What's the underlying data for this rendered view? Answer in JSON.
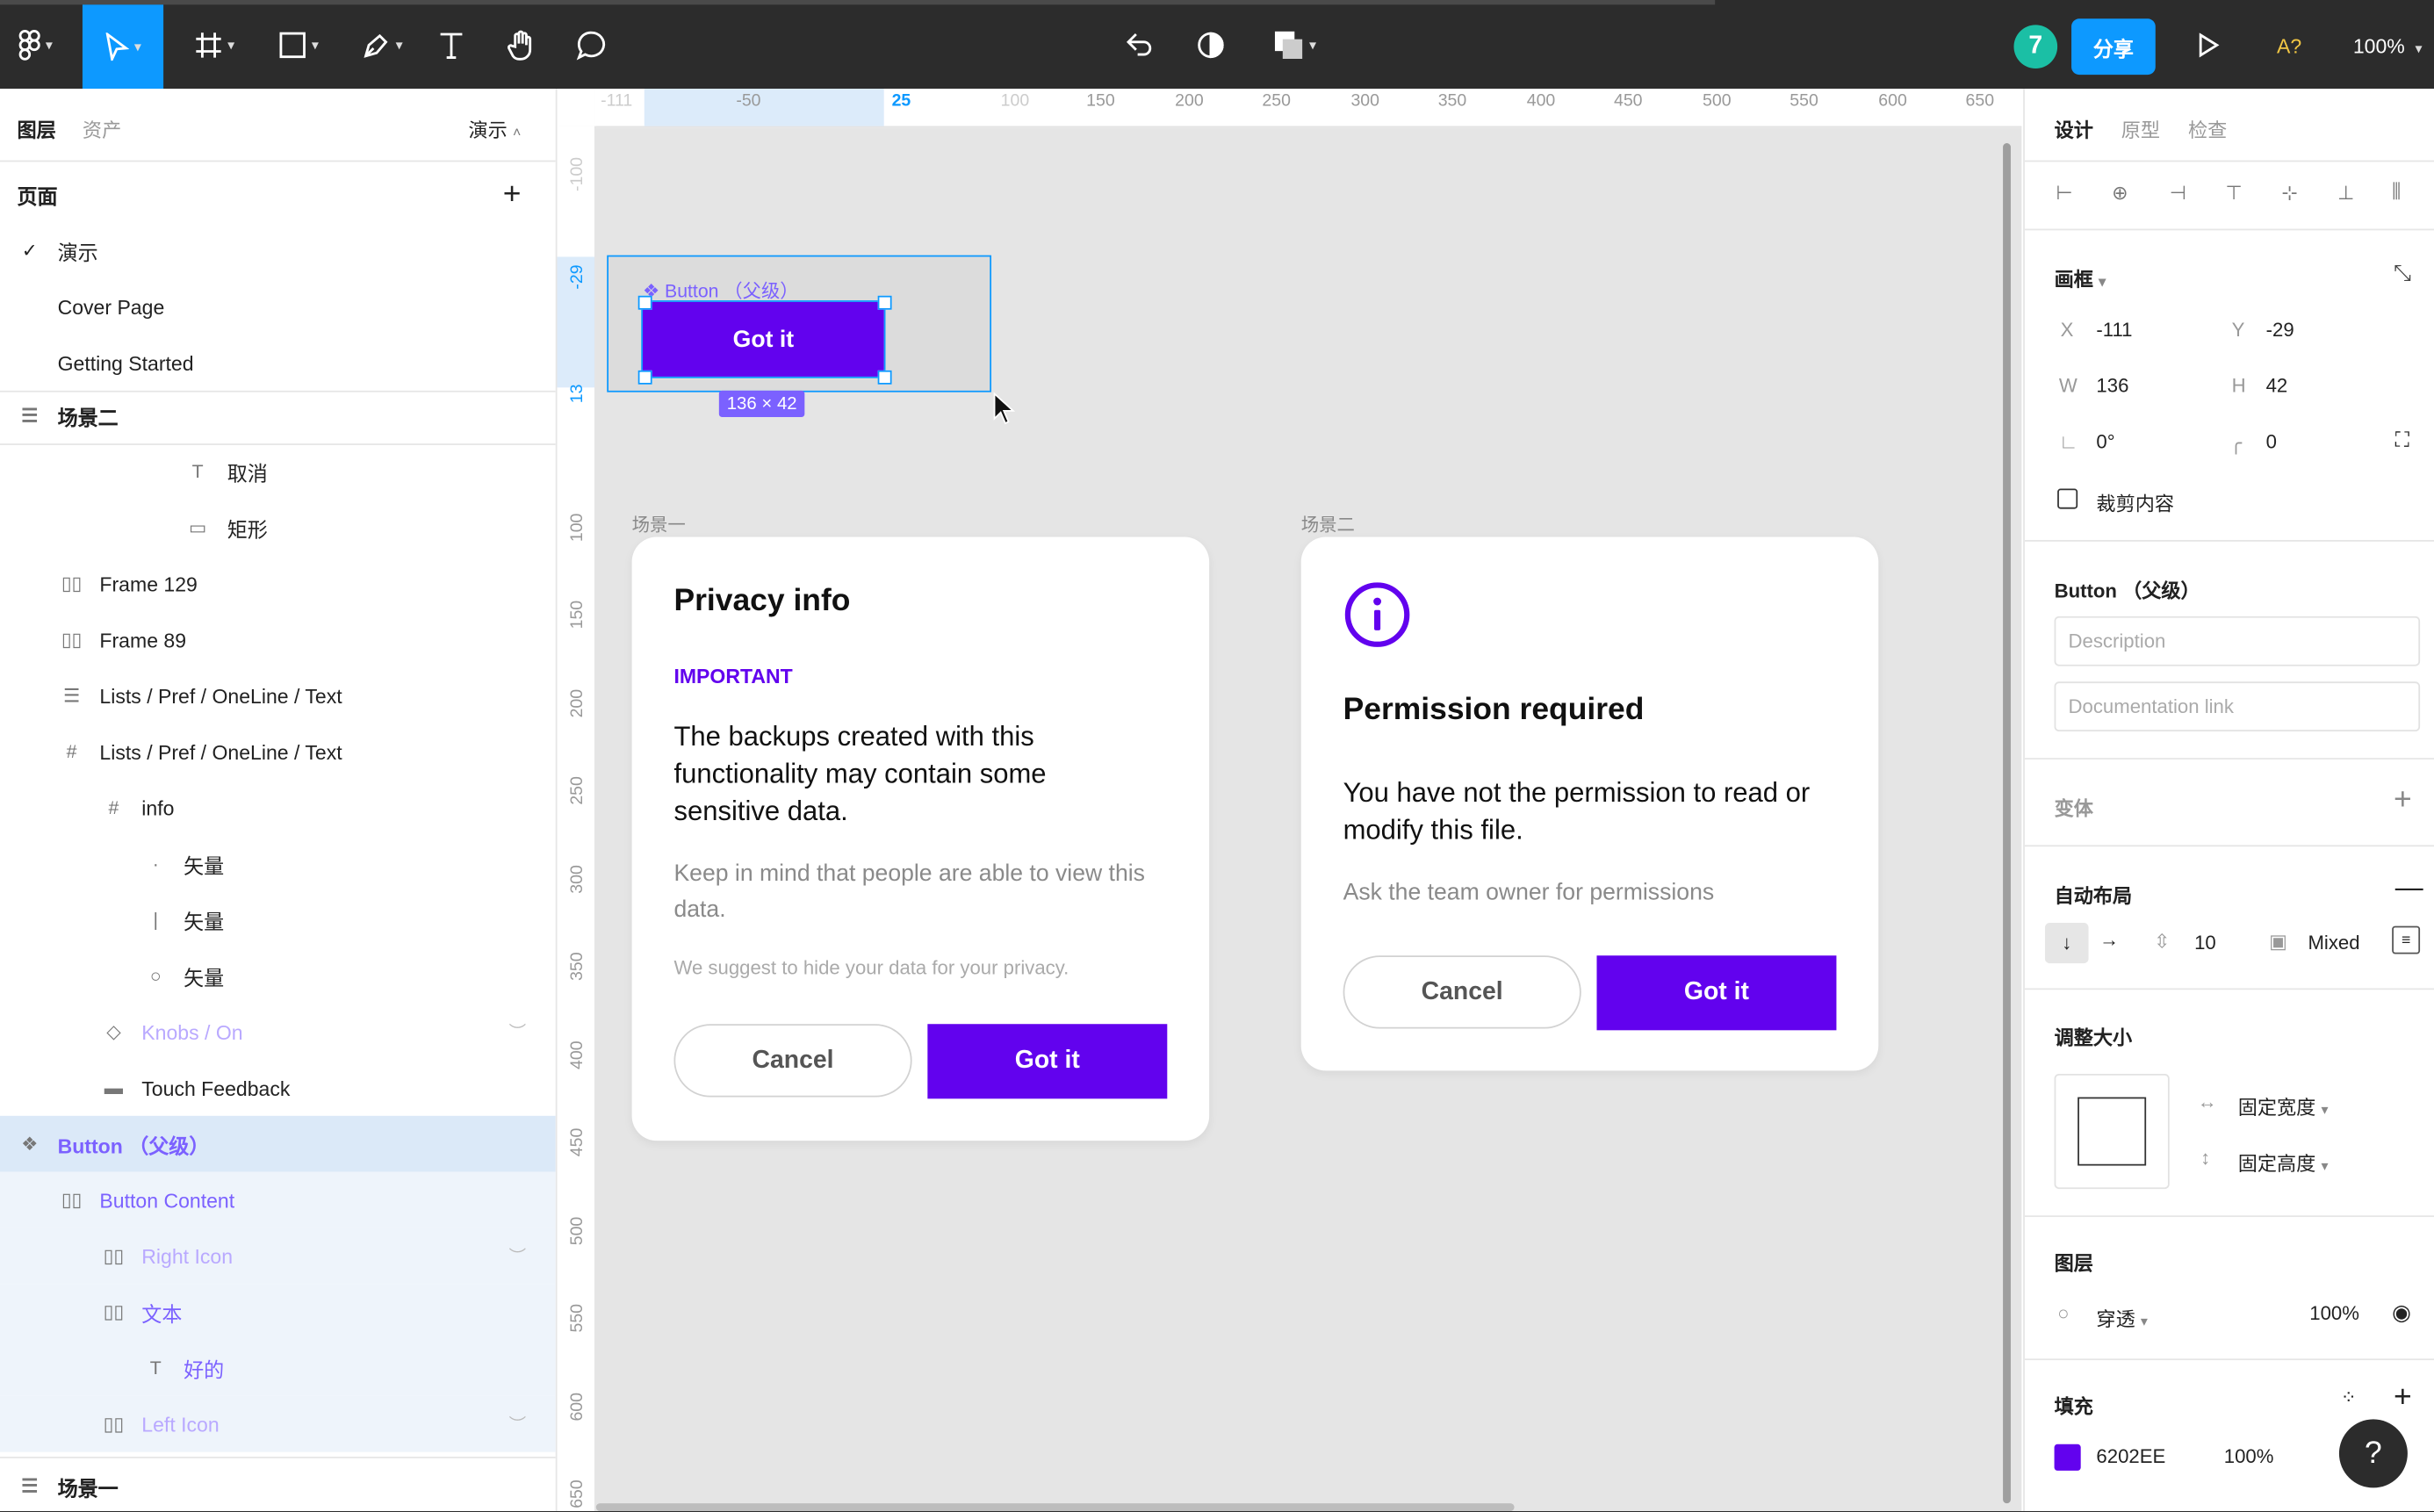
{
  "toolbar": {
    "share_label": "分享",
    "zoom_label": "100%",
    "a11y_label": "A?",
    "avatar_letter": "7"
  },
  "left_panel": {
    "tabs": {
      "layers": "图层",
      "assets": "资产",
      "mode": "演示"
    },
    "pages_header": "页面",
    "pages": [
      "演示",
      "Cover Page",
      "Getting Started"
    ],
    "layers": [
      {
        "label": "场景二"
      },
      {
        "label": "取消"
      },
      {
        "label": "矩形"
      },
      {
        "label": "Frame 129"
      },
      {
        "label": "Frame 89"
      },
      {
        "label": "Lists / Pref / OneLine / Text"
      },
      {
        "label": "Lists / Pref / OneLine / Text"
      },
      {
        "label": "info"
      },
      {
        "label": "矢量"
      },
      {
        "label": "矢量"
      },
      {
        "label": "矢量"
      },
      {
        "label": "Knobs / On"
      },
      {
        "label": "Touch Feedback"
      },
      {
        "label": "Button （父级）"
      },
      {
        "label": "Button Content"
      },
      {
        "label": "Right Icon"
      },
      {
        "label": "文本"
      },
      {
        "label": "好的"
      },
      {
        "label": "Left Icon"
      },
      {
        "label": "场景一"
      }
    ]
  },
  "rulers": {
    "h_ticks": [
      "-111",
      "-50",
      "25",
      "100",
      "150",
      "200",
      "250",
      "300",
      "350",
      "400",
      "450",
      "500",
      "550",
      "600",
      "650"
    ],
    "v_ticks": [
      "-100",
      "-29",
      "13",
      "100",
      "150",
      "200",
      "250",
      "300",
      "350",
      "400",
      "450",
      "500",
      "550",
      "600",
      "650"
    ]
  },
  "canvas": {
    "selected_component_label": "Button （父级）",
    "selected_button_label": "Got it",
    "size_badge": "136 × 42",
    "frame1_label": "场景一",
    "frame2_label": "场景二",
    "card1": {
      "title": "Privacy info",
      "overline": "IMPORTANT",
      "body": "The backups created with this functionality may contain some sensitive data.",
      "secondary": "Keep in mind that people are able to view this data.",
      "tertiary": "We suggest to hide your data for your privacy.",
      "cancel": "Cancel",
      "confirm": "Got it"
    },
    "card2": {
      "title": "Permission required",
      "body": "You have not the permission to read or modify this file.",
      "secondary": "Ask the team owner for permissions",
      "cancel": "Cancel",
      "confirm": "Got it"
    }
  },
  "right_panel": {
    "tabs": [
      "设计",
      "原型",
      "检查"
    ],
    "frame_header": "画框",
    "x_label": "X",
    "x_value": "-111",
    "y_label": "Y",
    "y_value": "-29",
    "w_label": "W",
    "w_value": "136",
    "h_label": "H",
    "h_value": "42",
    "rotation_value": "0°",
    "radius_value": "0",
    "clip_label": "裁剪内容",
    "component_title": "Button （父级）",
    "description_placeholder": "Description",
    "doc_link_placeholder": "Documentation link",
    "variants_label": "变体",
    "autolayout_label": "自动布局",
    "spacing_value": "10",
    "padding_value": "Mixed",
    "resize_label": "调整大小",
    "fixed_width": "固定宽度",
    "fixed_height": "固定高度",
    "layer_label": "图层",
    "blend_mode": "穿透",
    "layer_opacity": "100%",
    "fill_label": "填充",
    "fill_hex": "6202EE",
    "fill_opacity": "100%"
  },
  "colors": {
    "accent": "#0d99ff",
    "brand_purple": "#6202ee",
    "component_purple": "#7b61ff"
  }
}
